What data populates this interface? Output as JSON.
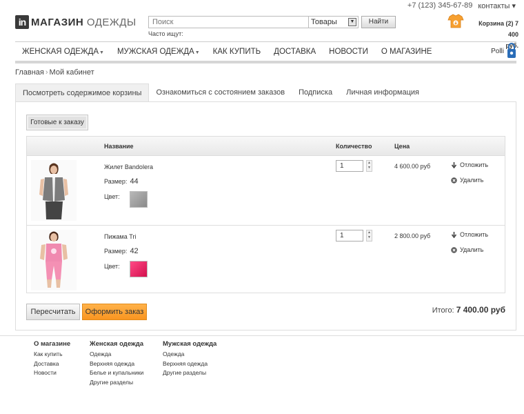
{
  "top": {
    "phone": "+7 (123) 345-67-89",
    "contacts": "контакты ▾"
  },
  "logo": {
    "badge": "in",
    "bold": "МАГАЗИН",
    "light": "ОДЕЖДЫ"
  },
  "search": {
    "placeholder": "Поиск",
    "category": "Товары",
    "button": "Найти",
    "hint": "Часто ищут:"
  },
  "cart_top": {
    "line1": "Корзина (2) 7 400",
    "line2": "руб."
  },
  "nav": {
    "items": [
      {
        "label": "ЖЕНСКАЯ ОДЕЖДА",
        "caret": true
      },
      {
        "label": "МУЖСКАЯ ОДЕЖДА",
        "caret": true
      },
      {
        "label": "КАК КУПИТЬ",
        "caret": false
      },
      {
        "label": "ДОСТАВКА",
        "caret": false
      },
      {
        "label": "НОВОСТИ",
        "caret": false
      },
      {
        "label": "О МАГАЗИНЕ",
        "caret": false
      }
    ],
    "user": "Polli"
  },
  "breadcrumb": {
    "home": "Главная",
    "sep": "›",
    "current": "Мой кабинет"
  },
  "tabs": [
    "Посмотреть содержимое корзины",
    "Ознакомиться с состоянием заказов",
    "Подписка",
    "Личная информация"
  ],
  "ready_button": "Готовые к заказу",
  "cart": {
    "columns": {
      "name": "Название",
      "qty": "Количество",
      "price": "Цена"
    },
    "size_label": "Размер:",
    "color_label": "Цвет:",
    "defer_label": "Отложить",
    "delete_label": "Удалить",
    "items": [
      {
        "name": "Жилет Bandolera",
        "size": "44",
        "color": "#9a9a9a",
        "qty": "1",
        "price": "4 600.00 руб"
      },
      {
        "name": "Пижама Tri",
        "size": "42",
        "color": "#e8185a",
        "qty": "1",
        "price": "2 800.00 руб"
      }
    ]
  },
  "actions": {
    "recalc": "Пересчитать",
    "order": "Оформить заказ",
    "total_label": "Итого:",
    "total_value": "7 400.00 руб"
  },
  "footer": {
    "columns": [
      {
        "title": "О магазине",
        "links": [
          "Как купить",
          "Доставка",
          "Новости"
        ]
      },
      {
        "title": "Женская одежда",
        "links": [
          "Одежда",
          "Верхняя одежда",
          "Белье и купальники",
          "Другие разделы"
        ]
      },
      {
        "title": "Мужская одежда",
        "links": [
          "Одежда",
          "Верхняя одежда",
          "Другие разделы"
        ]
      }
    ]
  }
}
